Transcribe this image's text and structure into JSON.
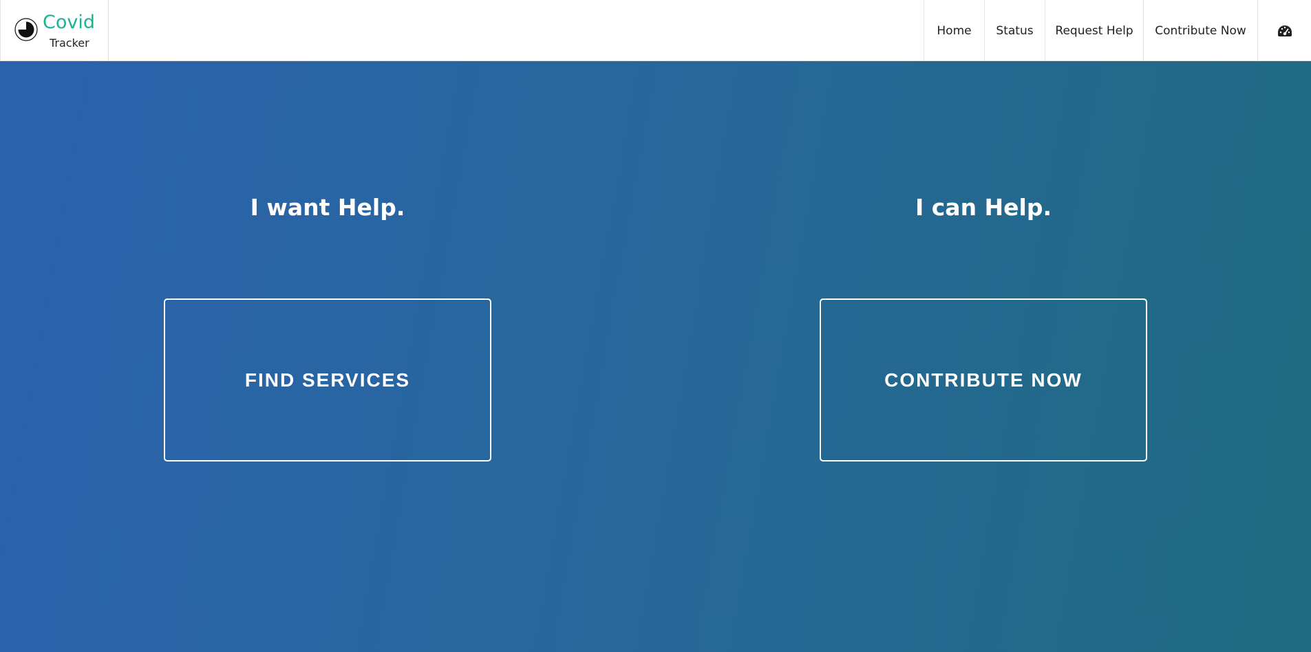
{
  "brand": {
    "title": "Covid",
    "subtitle": "Tracker",
    "accent_color": "#1ab394",
    "logo_icon": "circle-logo-icon"
  },
  "nav": {
    "items": [
      {
        "label": "Home"
      },
      {
        "label": "Status"
      },
      {
        "label": "Request Help"
      },
      {
        "label": "Contribute Now"
      }
    ],
    "dashboard_icon": "dashboard-gauge-icon"
  },
  "hero": {
    "left": {
      "heading": "I want Help.",
      "button_label": "FIND SERVICES"
    },
    "right": {
      "heading": "I can Help.",
      "button_label": "CONTRIBUTE NOW"
    },
    "gradient_colors": [
      "#2b62ad",
      "#27679a",
      "#1f6a80"
    ]
  }
}
